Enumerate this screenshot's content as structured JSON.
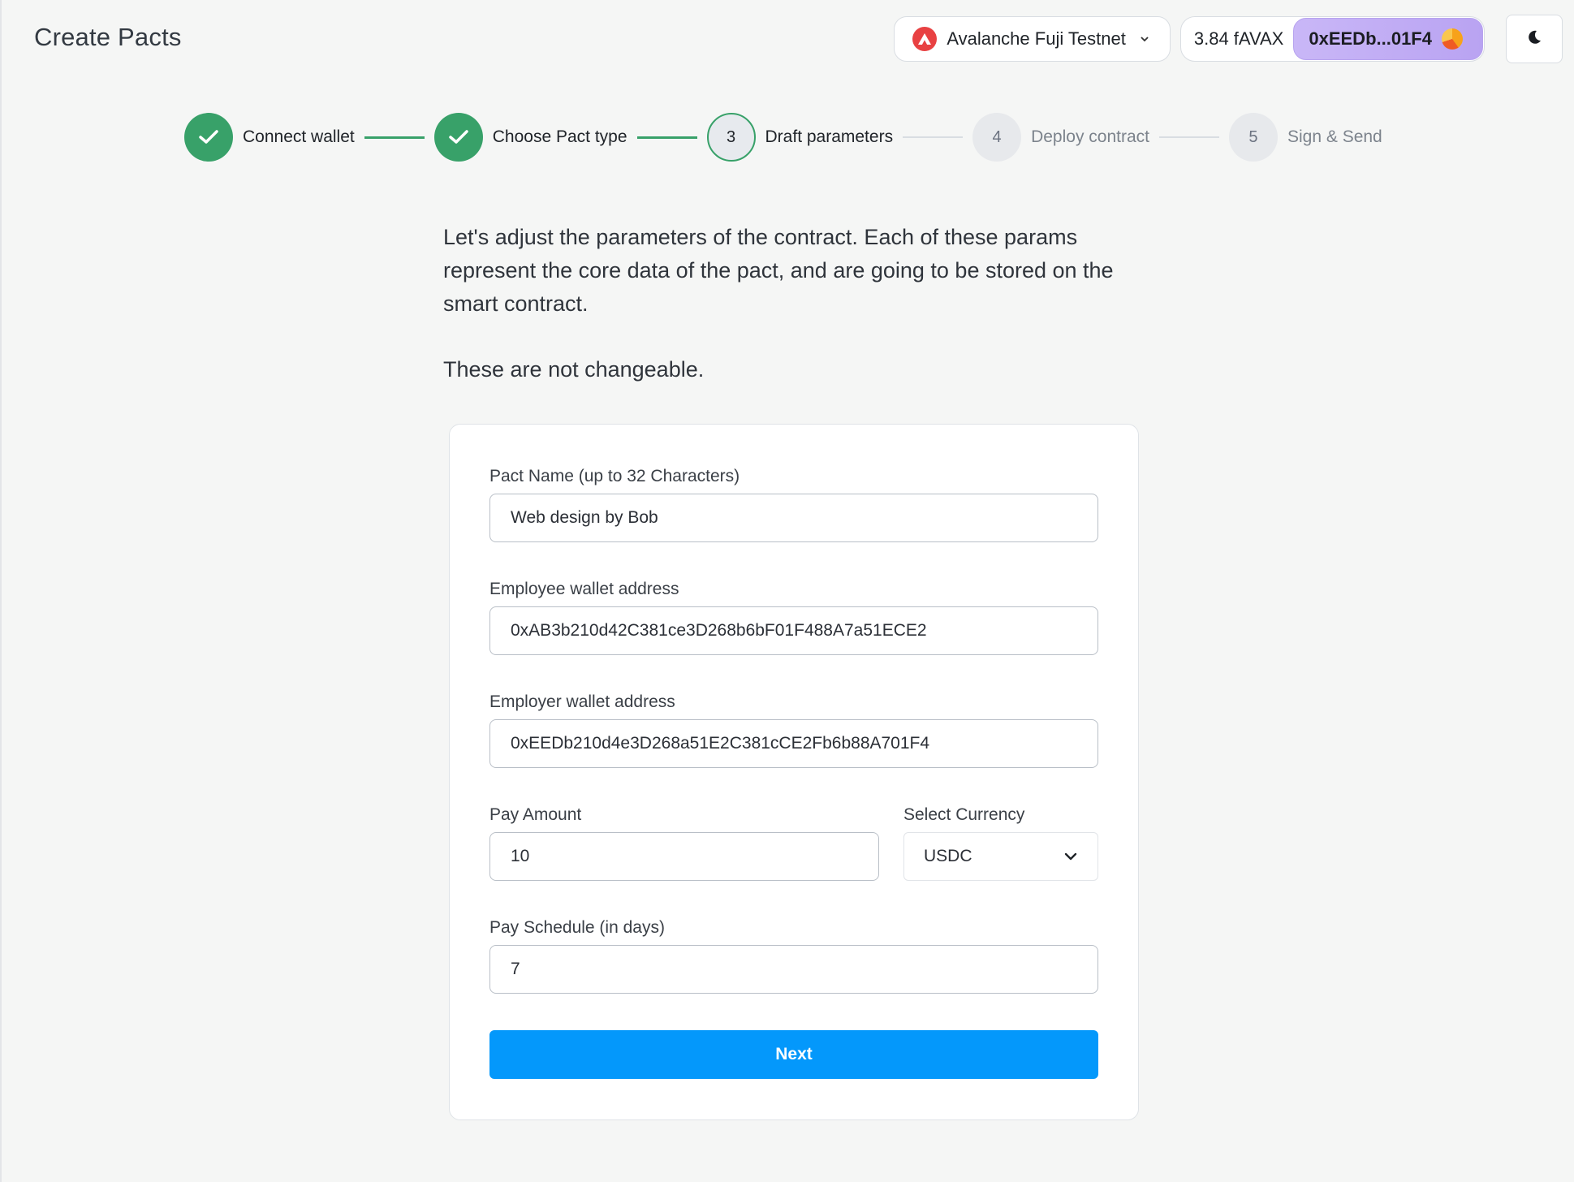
{
  "header": {
    "title": "Create Pacts",
    "network": {
      "name": "Avalanche Fuji Testnet",
      "icon": "avalanche-icon",
      "color": "#e84142"
    },
    "balance": "3.84 fAVAX",
    "address": "0xEEDb...01F4",
    "theme_icon": "moon-icon"
  },
  "stepper": {
    "steps": [
      {
        "label": "Connect wallet",
        "number": "1",
        "status": "done"
      },
      {
        "label": "Choose Pact type",
        "number": "2",
        "status": "done"
      },
      {
        "label": "Draft parameters",
        "number": "3",
        "status": "active"
      },
      {
        "label": "Deploy contract",
        "number": "4",
        "status": "todo"
      },
      {
        "label": "Sign & Send",
        "number": "5",
        "status": "todo"
      }
    ],
    "colors": {
      "done": "#38a169",
      "todo": "#e7e9ec"
    }
  },
  "intro": {
    "paragraph1": "Let's adjust the parameters of the contract. Each of these params represent the core data of the pact, and are going to be stored on the smart contract.",
    "paragraph2": "These are not changeable."
  },
  "form": {
    "pact_name": {
      "label": "Pact Name (up to 32 Characters)",
      "value": "Web design by Bob"
    },
    "employee_wallet": {
      "label": "Employee wallet address",
      "value": "0xAB3b210d42C381ce3D268b6bF01F488A7a51ECE2"
    },
    "employer_wallet": {
      "label": "Employer wallet address",
      "value": "0xEEDb210d4e3D268a51E2C381cCE2Fb6b88A701F4"
    },
    "pay_amount": {
      "label": "Pay Amount",
      "value": "10"
    },
    "currency": {
      "label": "Select Currency",
      "value": "USDC"
    },
    "pay_schedule": {
      "label": "Pay Schedule (in days)",
      "value": "7"
    },
    "next_label": "Next",
    "accent": "#0498fb"
  }
}
